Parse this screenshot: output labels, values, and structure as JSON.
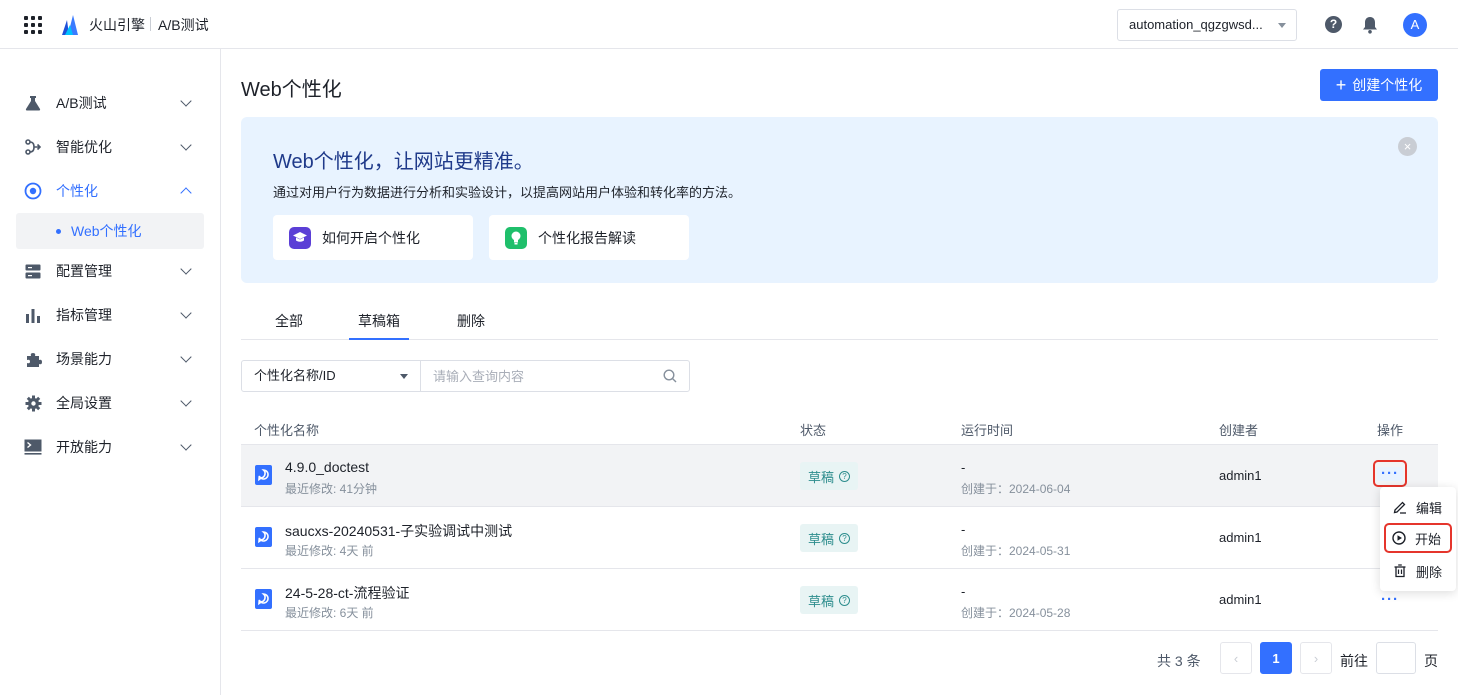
{
  "header": {
    "brand": "火山引擎",
    "product": "A/B测试",
    "app_selector": "automation_qgzgwsd...",
    "avatar_letter": "A"
  },
  "sidebar": {
    "items": [
      {
        "label": "A/B测试",
        "icon": "flask-icon"
      },
      {
        "label": "智能优化",
        "icon": "branch-icon"
      },
      {
        "label": "个性化",
        "icon": "target-icon"
      },
      {
        "label": "配置管理",
        "icon": "server-icon"
      },
      {
        "label": "指标管理",
        "icon": "bar-chart-icon"
      },
      {
        "label": "场景能力",
        "icon": "puzzle-icon"
      },
      {
        "label": "全局设置",
        "icon": "gear-icon"
      },
      {
        "label": "开放能力",
        "icon": "terminal-icon"
      }
    ],
    "sub_item": "Web个性化"
  },
  "page": {
    "title": "Web个性化",
    "create_button": "创建个性化"
  },
  "banner": {
    "title": "Web个性化，让网站更精准。",
    "description": "通过对用户行为数据进行分析和实验设计，以提高网站用户体验和转化率的方法。",
    "cards": [
      "如何开启个性化",
      "个性化报告解读"
    ]
  },
  "tabs": [
    "全部",
    "草稿箱",
    "删除"
  ],
  "filter": {
    "field": "个性化名称/ID",
    "placeholder": "请输入查询内容"
  },
  "table": {
    "headers": [
      "个性化名称",
      "状态",
      "运行时间",
      "创建者",
      "操作"
    ],
    "rows": [
      {
        "name": "4.9.0_doctest",
        "modified": "最近修改: 41分钟",
        "status": "草稿",
        "run_time": "-",
        "created": "创建于：2024-06-04",
        "creator": "admin1"
      },
      {
        "name": "saucxs-20240531-子实验调试中测试",
        "modified": "最近修改: 4天 前",
        "status": "草稿",
        "run_time": "-",
        "created": "创建于：2024-05-31",
        "creator": "admin1"
      },
      {
        "name": "24-5-28-ct-流程验证",
        "modified": "最近修改: 6天 前",
        "status": "草稿",
        "run_time": "-",
        "created": "创建于：2024-05-28",
        "creator": "admin1"
      }
    ]
  },
  "menu": {
    "items": [
      "编辑",
      "开始",
      "删除"
    ]
  },
  "pagination": {
    "total": "共 3 条",
    "current": "1",
    "goto_label": "前往",
    "page_unit": "页"
  },
  "colors": {
    "primary": "#3370ff",
    "highlight": "#e5352c",
    "banner_bg": "#e8f3ff"
  }
}
